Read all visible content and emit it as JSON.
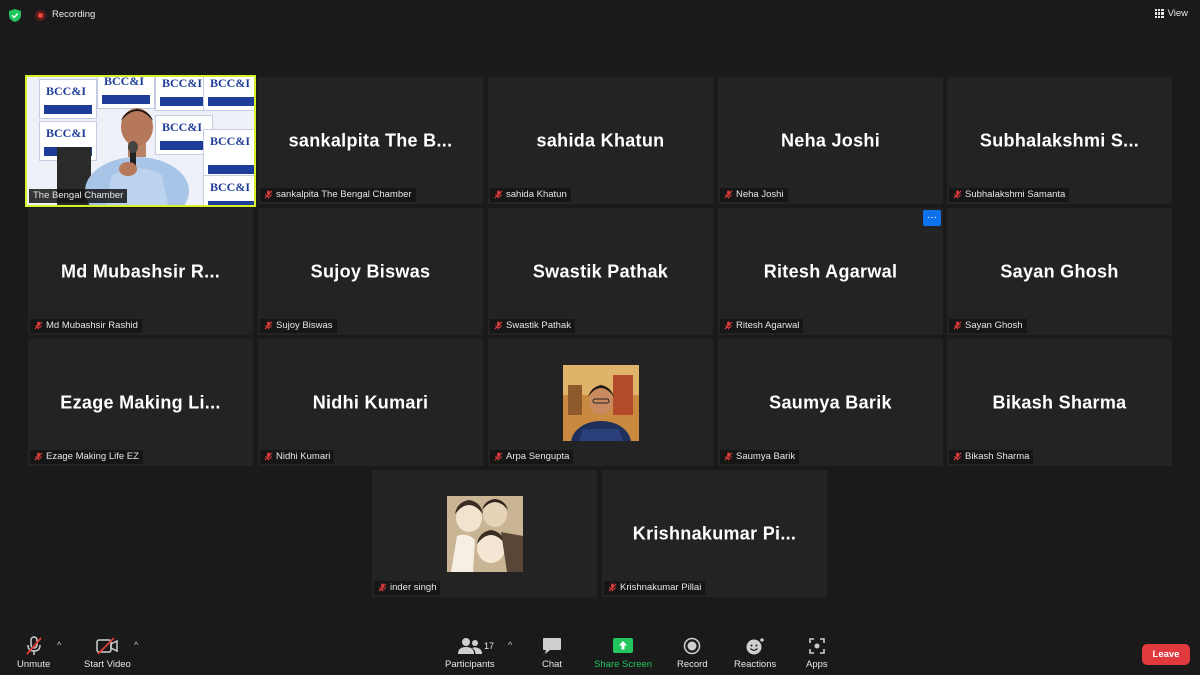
{
  "topbar": {
    "recording_label": "Recording",
    "view_label": "View"
  },
  "speaker": {
    "name": "The Bengal Chamber",
    "banner_text": "BCC&I"
  },
  "participants": [
    {
      "display": "sankalpita The B...",
      "label": "sankalpita The Bengal Chamber"
    },
    {
      "display": "sahida Khatun",
      "label": "sahida Khatun"
    },
    {
      "display": "Neha Joshi",
      "label": "Neha Joshi"
    },
    {
      "display": "Subhalakshmi S...",
      "label": "Subhalakshmi Samanta"
    },
    {
      "display": "Md Mubashsir R...",
      "label": "Md Mubashsir Rashid"
    },
    {
      "display": "Sujoy Biswas",
      "label": "Sujoy Biswas"
    },
    {
      "display": "Swastik Pathak",
      "label": "Swastik Pathak"
    },
    {
      "display": "Ritesh Agarwal",
      "label": "Ritesh Agarwal"
    },
    {
      "display": "Sayan Ghosh",
      "label": "Sayan Ghosh"
    },
    {
      "display": "Ezage Making Li...",
      "label": "Ezage Making Life EZ"
    },
    {
      "display": "Nidhi Kumari",
      "label": "Nidhi Kumari"
    },
    {
      "display": "",
      "label": "Arpa Sengupta"
    },
    {
      "display": "Saumya Barik",
      "label": "Saumya Barik"
    },
    {
      "display": "Bikash Sharma",
      "label": "Bikash Sharma"
    },
    {
      "display": "",
      "label": "inder singh"
    },
    {
      "display": "Krishnakumar Pi...",
      "label": "Krishnakumar Pillai"
    }
  ],
  "more_button": "···",
  "toolbar": {
    "unmute": "Unmute",
    "start_video": "Start Video",
    "participants": "Participants",
    "participant_count": "17",
    "chat": "Chat",
    "share_screen": "Share Screen",
    "record": "Record",
    "reactions": "Reactions",
    "apps": "Apps",
    "leave": "Leave"
  },
  "colors": {
    "active_speaker_border": "#d8f02a",
    "share_screen_green": "#22c55e",
    "leave_red": "#e0393e",
    "more_blue": "#0e72ed"
  }
}
